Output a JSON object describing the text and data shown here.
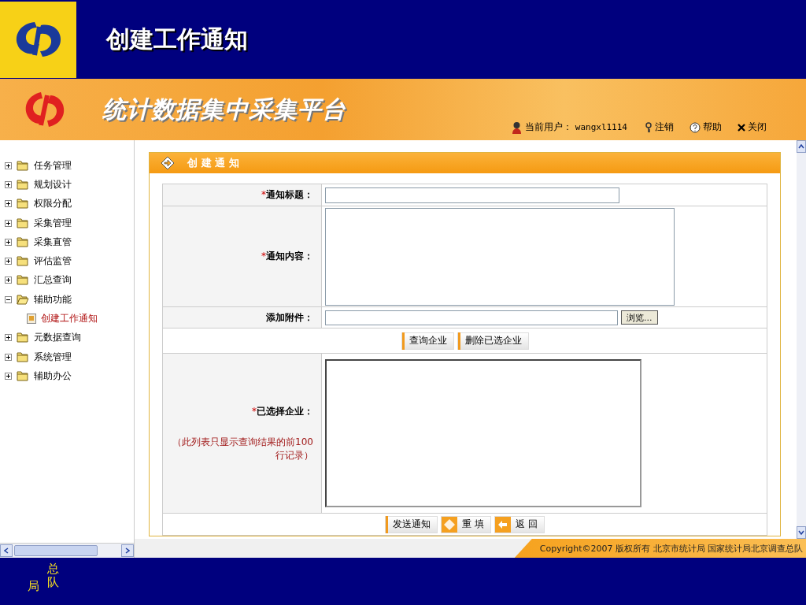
{
  "slide": {
    "title": "创建工作通知",
    "corner_texts": [
      "局",
      "总队"
    ]
  },
  "banner": {
    "title": "统计数据集中采集平台",
    "user_label": "当前用户：",
    "username": "wangxl1114",
    "links": [
      {
        "label": "注销",
        "kind": "logout"
      },
      {
        "label": "帮助",
        "kind": "help"
      },
      {
        "label": "关闭",
        "kind": "close"
      }
    ]
  },
  "sidebar": {
    "items": [
      {
        "label": "任务管理",
        "expanded": false
      },
      {
        "label": "规划设计",
        "expanded": false
      },
      {
        "label": "权限分配",
        "expanded": false
      },
      {
        "label": "采集管理",
        "expanded": false
      },
      {
        "label": "采集直管",
        "expanded": false
      },
      {
        "label": "评估监管",
        "expanded": false
      },
      {
        "label": "汇总查询",
        "expanded": false
      },
      {
        "label": "辅助功能",
        "expanded": true,
        "children": [
          {
            "label": "创建工作通知",
            "selected": true
          }
        ]
      },
      {
        "label": "元数据查询",
        "expanded": false
      },
      {
        "label": "系统管理",
        "expanded": false
      },
      {
        "label": "辅助办公",
        "expanded": false
      }
    ]
  },
  "form": {
    "header": "创 建 通 知",
    "fields": [
      {
        "kind": "input",
        "mark": "*",
        "label": "通知标题："
      },
      {
        "kind": "textarea",
        "mark": "*",
        "label": "通知内容："
      },
      {
        "kind": "file",
        "label": "添加附件：",
        "button": "浏览..."
      }
    ],
    "query_buttons": [
      "查询企业",
      "删除已选企业"
    ],
    "selected_list": {
      "mark": "*",
      "label": "已选择企业：",
      "note": "（此列表只显示查询结果的前100行记录）"
    },
    "action_buttons": [
      {
        "label": "发送通知",
        "kind": "bar"
      },
      {
        "label": "重 填",
        "kind": "reset"
      },
      {
        "label": "返 回",
        "kind": "back"
      }
    ]
  },
  "copyright": "Copyright©2007 版权所有 北京市统计局 国家统计局北京调查总队"
}
